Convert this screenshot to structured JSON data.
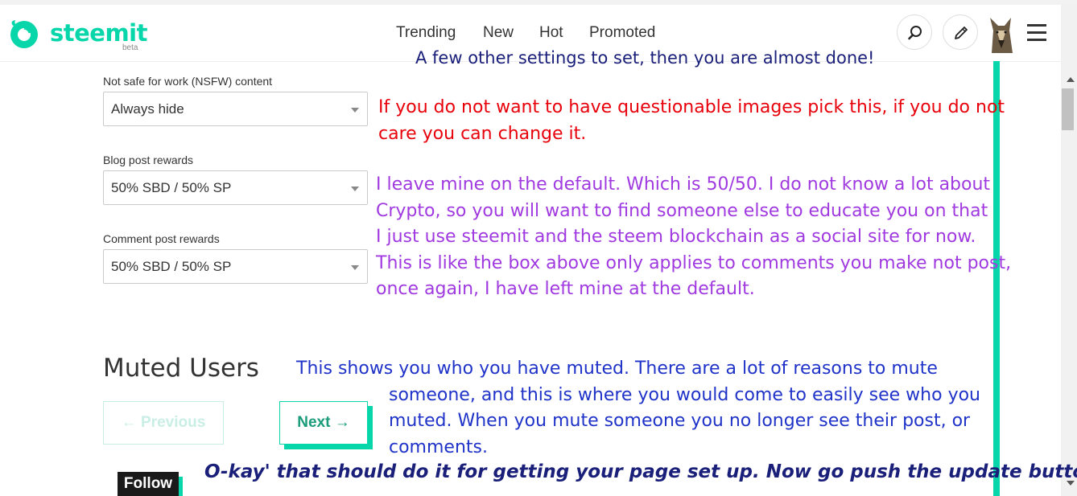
{
  "brand": {
    "name": "steemit",
    "tag": "beta",
    "color": "#06d6a9"
  },
  "nav": {
    "items": [
      "Trending",
      "New",
      "Hot",
      "Promoted"
    ]
  },
  "header_icons": {
    "search": "search-icon",
    "edit": "pencil-icon",
    "menu": "hamburger-icon"
  },
  "settings": {
    "nsfw": {
      "label": "Not safe for work (NSFW) content",
      "value": "Always hide"
    },
    "blog_rewards": {
      "label": "Blog post rewards",
      "value": "50% SBD / 50% SP"
    },
    "comment_rewards": {
      "label": "Comment post rewards",
      "value": "50% SBD / 50% SP"
    }
  },
  "muted": {
    "title": "Muted Users",
    "prev_label": "← Previous",
    "next_label": "Next →"
  },
  "follow_label": "Follow",
  "annotations": {
    "top": "A few other settings to set, then you are almost done!",
    "red": [
      "If you do not want to have questionable images pick this, if you do not",
      "care you can change it."
    ],
    "purple": [
      "I leave mine on the default. Which is 50/50. I do not know a lot about",
      "Crypto, so you will want to find someone else to educate you on that",
      "I just use steemit and the steem blockchain as a social site for now.",
      "This is like the box above only applies to comments you make not post,",
      "once again, I have left mine at the default."
    ],
    "blue": [
      "This shows you who you have muted. There are a lot of reasons to mute",
      "someone, and this is where you would come to easily see who you",
      "muted. When you mute someone you no longer see their post, or",
      "comments."
    ],
    "final": "O-kay' that should do it for getting your page set up. Now go push the update button!"
  },
  "colors": {
    "annotation_top": "#1a1f7a",
    "annotation_red": "#e8000b",
    "annotation_purple": "#a03ae0",
    "annotation_blue": "#1f33c8",
    "accent": "#06d6a9"
  }
}
